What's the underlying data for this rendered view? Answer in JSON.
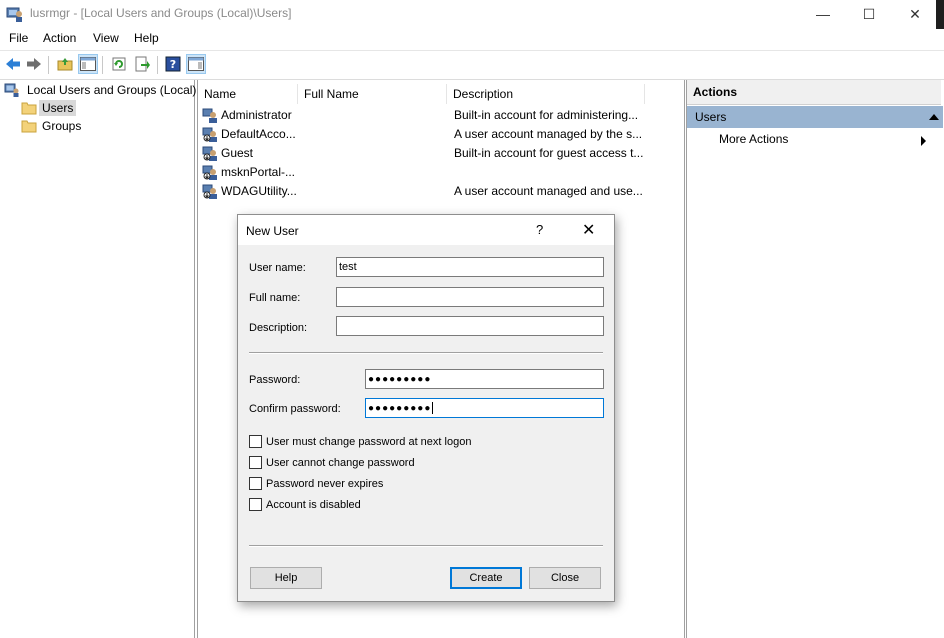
{
  "window": {
    "title": "lusrmgr - [Local Users and Groups (Local)\\Users]",
    "controls": {
      "minimize": "—",
      "maximize": "☐",
      "close": "✕"
    }
  },
  "menu": [
    "File",
    "Action",
    "View",
    "Help"
  ],
  "toolbar": {
    "icons": [
      "back-arrow-icon",
      "forward-arrow-icon",
      "up-folder-icon",
      "show-hide-tree-icon",
      "refresh-icon",
      "export-list-icon",
      "help-icon",
      "show-hide-action-pane-icon"
    ]
  },
  "tree": {
    "root": "Local Users and Groups (Local)",
    "children": [
      "Users",
      "Groups"
    ],
    "selected": "Users"
  },
  "list": {
    "columns": [
      "Name",
      "Full Name",
      "Description"
    ],
    "rows": [
      {
        "name": "Administrator",
        "full_name": "",
        "description": "Built-in account for administering..."
      },
      {
        "name": "DefaultAcco...",
        "full_name": "",
        "description": "A user account managed by the s..."
      },
      {
        "name": "Guest",
        "full_name": "",
        "description": "Built-in account for guest access t..."
      },
      {
        "name": "msknPortal-...",
        "full_name": "",
        "description": ""
      },
      {
        "name": "WDAGUtility...",
        "full_name": "",
        "description": "A user account managed and use..."
      }
    ]
  },
  "actions": {
    "header": "Actions",
    "group": "Users",
    "more": "More Actions"
  },
  "dialog": {
    "title": "New User",
    "help_glyph": "?",
    "close_glyph": "✕",
    "fields": {
      "user_name": {
        "label": "User name:",
        "value": "test"
      },
      "full_name": {
        "label": "Full name:",
        "value": ""
      },
      "description": {
        "label": "Description:",
        "value": ""
      },
      "password": {
        "label": "Password:",
        "value": "●●●●●●●●●"
      },
      "confirm_password": {
        "label": "Confirm password:",
        "value": "●●●●●●●●●"
      }
    },
    "checkboxes": [
      {
        "label": "User must change password at next logon",
        "checked": false
      },
      {
        "label": "User cannot change password",
        "checked": false
      },
      {
        "label": "Password never expires",
        "checked": false
      },
      {
        "label": "Account is disabled",
        "checked": false
      }
    ],
    "buttons": {
      "help": "Help",
      "create": "Create",
      "close": "Close"
    }
  }
}
